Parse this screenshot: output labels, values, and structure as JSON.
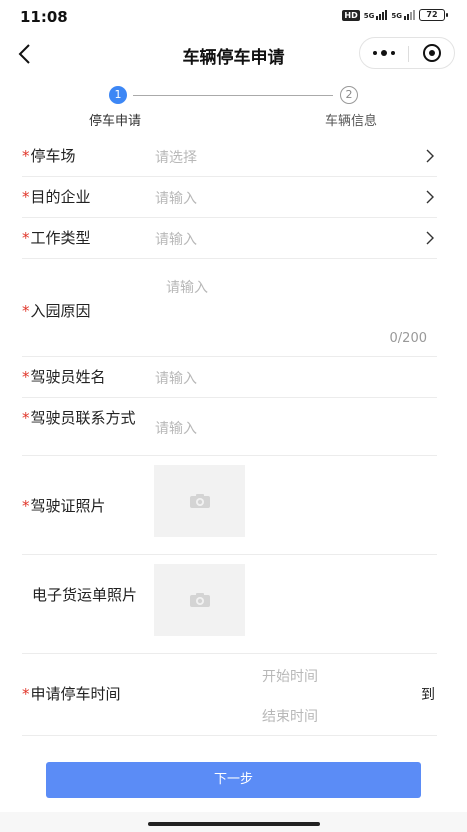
{
  "status_bar": {
    "time": "11:08",
    "hd": "HD",
    "signal1": "5G",
    "signal2": "5G",
    "battery": "72"
  },
  "nav": {
    "title": "车辆停车申请",
    "back_icon": "chevron-left-icon",
    "more_icon": "more-dots-icon",
    "close_icon": "target-close-icon"
  },
  "steps": [
    {
      "number": "1",
      "label": "停车申请",
      "active": true
    },
    {
      "number": "2",
      "label": "车辆信息",
      "active": false
    }
  ],
  "form": {
    "required_mark": "*",
    "parking_lot": {
      "label": "停车场",
      "placeholder": "请选择"
    },
    "target_company": {
      "label": "目的企业",
      "placeholder": "请输入"
    },
    "work_type": {
      "label": "工作类型",
      "placeholder": "请输入"
    },
    "entry_reason": {
      "label": "入园原因",
      "placeholder": "请输入",
      "counter": "0/200"
    },
    "driver_name": {
      "label": "驾驶员姓名",
      "placeholder": "请输入"
    },
    "driver_phone": {
      "label": "驾驶员联系方式",
      "placeholder": "请输入"
    },
    "license_photo": {
      "label": "驾驶证照片",
      "icon": "camera-icon"
    },
    "waybill_photo": {
      "label": "电子货运单照片",
      "icon": "camera-icon"
    },
    "parking_time": {
      "label": "申请停车时间",
      "start_placeholder": "开始时间",
      "end_placeholder": "结束时间",
      "to": "到"
    }
  },
  "next_button": "下一步",
  "colors": {
    "primary": "#5b8cf6",
    "step_active": "#3d87f5",
    "required": "#e0362a"
  }
}
